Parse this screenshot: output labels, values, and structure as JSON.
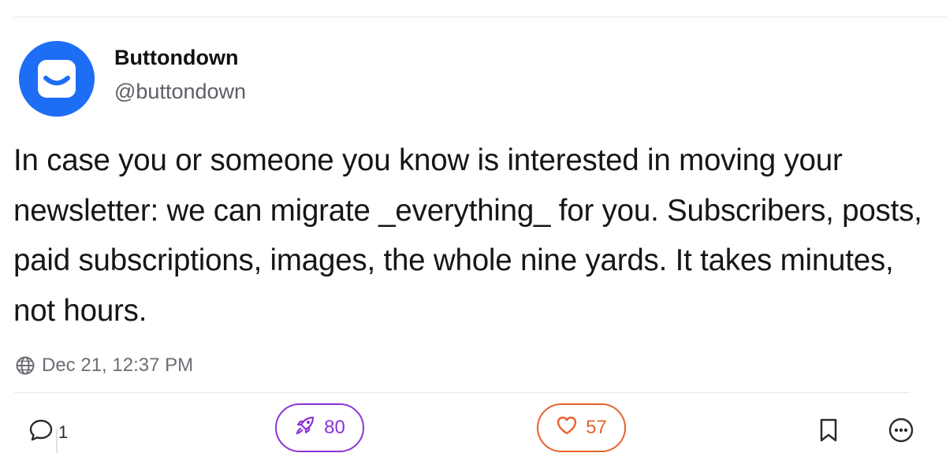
{
  "post": {
    "author": {
      "display_name": "Buttondown",
      "handle": "@buttondown",
      "avatar_color": "#1d6ef5"
    },
    "text": "In case you or someone you know is interested in moving your newsletter: we can migrate _everything_ for you. Subscribers, posts, paid subscriptions, images, the whole nine yards. It takes minutes, not hours.",
    "timestamp": "Dec 21, 12:37 PM",
    "visibility_icon": "globe-icon"
  },
  "actions": {
    "reply_count": "1",
    "boost_count": "80",
    "like_count": "57",
    "boost_color": "#8a34d8",
    "like_color": "#e8622b",
    "reply_icon": "speech-bubble-icon",
    "boost_icon": "rocket-icon",
    "like_icon": "heart-icon",
    "bookmark_icon": "bookmark-icon",
    "more_icon": "more-options-icon"
  }
}
